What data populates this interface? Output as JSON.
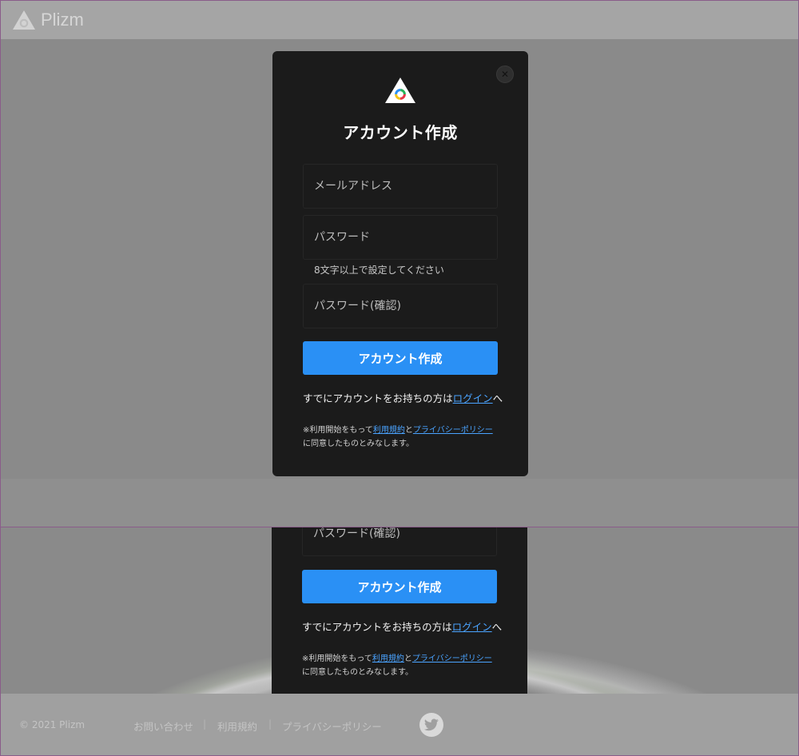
{
  "app": {
    "name": "Plizm"
  },
  "modal": {
    "title": "アカウント作成",
    "email_placeholder": "メールアドレス",
    "password_placeholder": "パスワード",
    "password_hint": "8文字以上で設定してください",
    "password_confirm_placeholder": "パスワード(確認)",
    "submit_label": "アカウント作成",
    "login_prefix": "すでにアカウントをお持ちの方は",
    "login_link": "ログイン",
    "login_suffix": "へ",
    "terms_prefix": "※利用開始をもって",
    "terms_link": "利用規約",
    "terms_and": "と",
    "privacy_link": "プライバシーポリシー",
    "terms_suffix": "に同意したものとみなします。",
    "close_icon": "close-icon"
  },
  "footer": {
    "copyright": "© 2021 Plizm",
    "links": [
      "お問い合わせ",
      "利用規約",
      "プライバシーポリシー"
    ],
    "social_icon": "twitter-icon"
  },
  "colors": {
    "accent": "#2a90f5",
    "link": "#4aa3ff",
    "modal_bg": "#1b1b1b",
    "overlay": "#8f8f8f"
  }
}
